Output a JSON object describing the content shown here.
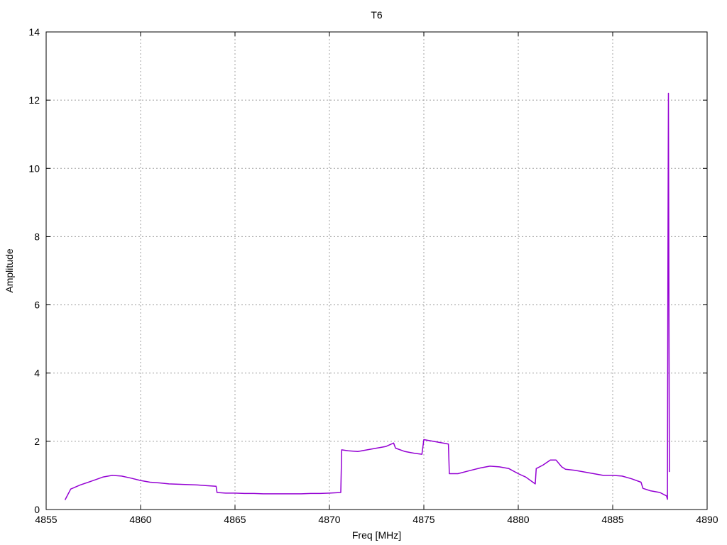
{
  "chart_data": {
    "type": "line",
    "title": "T6",
    "xlabel": "Freq [MHz]",
    "ylabel": "Amplitude",
    "xlim": [
      4855,
      4890
    ],
    "ylim": [
      0,
      14
    ],
    "xticks": [
      4855,
      4860,
      4865,
      4870,
      4875,
      4880,
      4885,
      4890
    ],
    "yticks": [
      0,
      2,
      4,
      6,
      8,
      10,
      12,
      14
    ],
    "grid": true,
    "line_color": "#9400d3",
    "series": [
      {
        "x": [
          4856.0,
          4856.3,
          4856.8,
          4857.5,
          4858.0,
          4858.5,
          4859.0,
          4859.5,
          4860.0,
          4860.5,
          4861.0,
          4861.5,
          4862.0,
          4862.5,
          4863.0,
          4863.5,
          4864.0,
          4864.05,
          4864.5,
          4865.0,
          4865.5,
          4866.0,
          4866.5,
          4867.0,
          4867.5,
          4868.0,
          4868.5,
          4869.0,
          4869.5,
          4870.0,
          4870.6,
          4870.65,
          4871.0,
          4871.5,
          4872.0,
          4872.5,
          4873.0,
          4873.4,
          4873.5,
          4874.0,
          4874.5,
          4874.9,
          4875.0,
          4875.5,
          4876.0,
          4876.3,
          4876.35,
          4876.8,
          4877.5,
          4878.0,
          4878.5,
          4879.0,
          4879.5,
          4880.0,
          4880.4,
          4880.9,
          4880.95,
          4881.3,
          4881.7,
          4882.0,
          4882.3,
          4882.5,
          4883.0,
          4883.5,
          4884.0,
          4884.5,
          4885.0,
          4885.5,
          4886.0,
          4886.5,
          4886.6,
          4887.0,
          4887.5,
          4887.85,
          4887.9,
          4887.92,
          4887.95,
          4888.0
        ],
        "y": [
          0.28,
          0.6,
          0.72,
          0.85,
          0.95,
          1.0,
          0.98,
          0.92,
          0.85,
          0.8,
          0.78,
          0.75,
          0.74,
          0.73,
          0.72,
          0.7,
          0.68,
          0.5,
          0.48,
          0.48,
          0.47,
          0.47,
          0.46,
          0.46,
          0.46,
          0.46,
          0.46,
          0.47,
          0.47,
          0.48,
          0.5,
          1.75,
          1.72,
          1.7,
          1.75,
          1.8,
          1.85,
          1.95,
          1.8,
          1.7,
          1.65,
          1.62,
          2.05,
          2.0,
          1.95,
          1.92,
          1.05,
          1.05,
          1.15,
          1.22,
          1.27,
          1.25,
          1.2,
          1.05,
          0.95,
          0.75,
          1.2,
          1.3,
          1.45,
          1.45,
          1.25,
          1.18,
          1.15,
          1.1,
          1.05,
          1.0,
          1.0,
          0.98,
          0.9,
          0.8,
          0.62,
          0.55,
          0.5,
          0.4,
          0.3,
          6.6,
          12.2,
          1.1
        ]
      }
    ]
  }
}
